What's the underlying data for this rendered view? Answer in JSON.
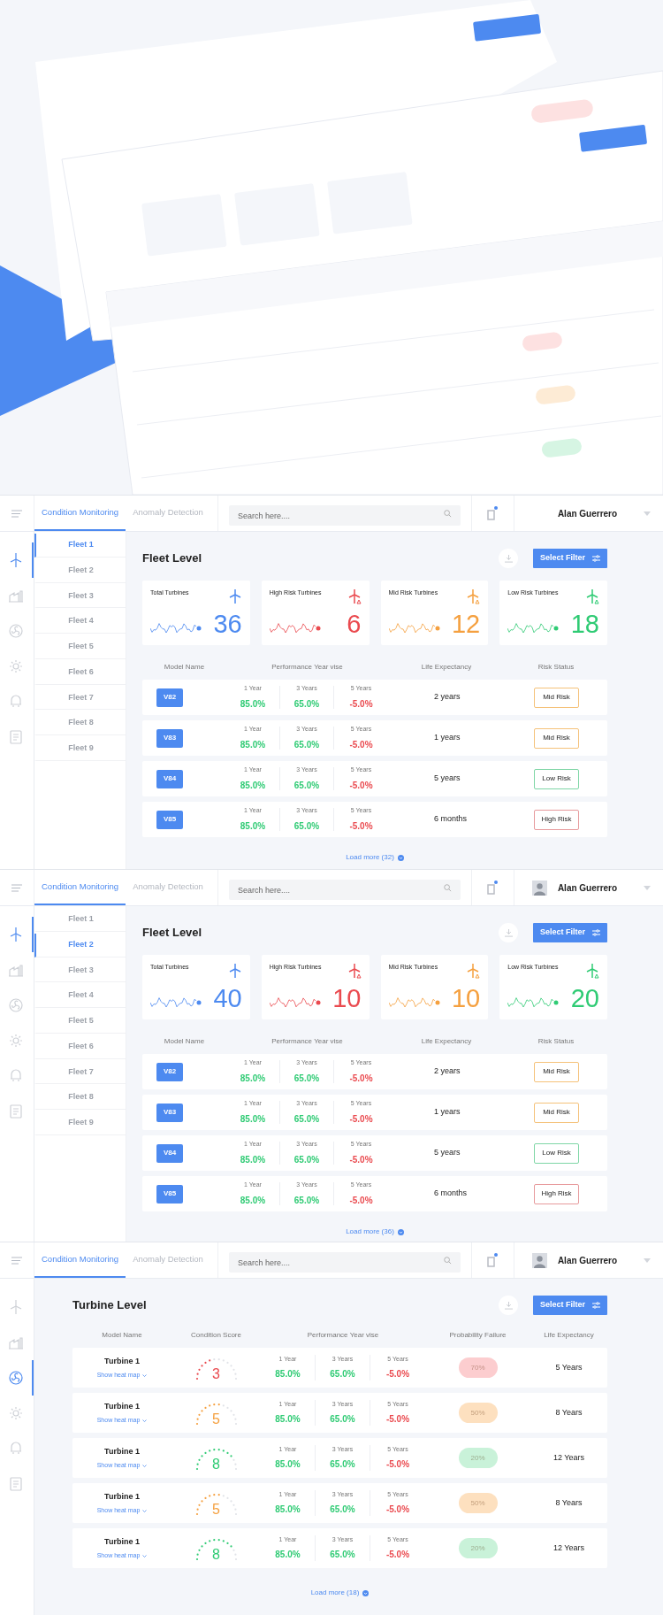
{
  "screens": [
    {
      "kind": "fleet",
      "header": {
        "tabs": [
          {
            "label": "Condition Monitoring",
            "selected": true
          },
          {
            "label": "Anomaly Detection",
            "selected": false
          }
        ],
        "search": {
          "placeholder": "Search here...."
        },
        "user": {
          "name": "Alan Guerrero",
          "avatar": false
        }
      },
      "rail": [
        {
          "selected": true
        },
        {
          "selected": false
        },
        {
          "selected": false
        },
        {
          "selected": false
        },
        {
          "selected": false
        },
        {
          "selected": false
        }
      ],
      "fleets": [
        {
          "label": "Fleet 1",
          "selected": true
        },
        {
          "label": "Fleet 2",
          "selected": false
        },
        {
          "label": "Fleet 3",
          "selected": false
        },
        {
          "label": "Fleet 4",
          "selected": false
        },
        {
          "label": "Fleet 5",
          "selected": false
        },
        {
          "label": "Fleet 6",
          "selected": false
        },
        {
          "label": "Fleet 7",
          "selected": false
        },
        {
          "label": "Fleet 8",
          "selected": false
        },
        {
          "label": "Fleet 9",
          "selected": false
        }
      ],
      "title": "Fleet Level",
      "filter_button": "Select Filter",
      "cards": [
        {
          "label": "Total Turbines",
          "value": "36",
          "color": "#4d8af0"
        },
        {
          "label": "High Risk Turbines",
          "value": "6",
          "color": "#ea4a4f"
        },
        {
          "label": "Mid Risk Turbines",
          "value": "12",
          "color": "#f5a03f"
        },
        {
          "label": "Low Risk Turbines",
          "value": "18",
          "color": "#2fcb74"
        }
      ],
      "columns": [
        "Model Name",
        "Performance Year vise",
        "Life Expectancy",
        "Risk Status"
      ],
      "rows": [
        {
          "model": "V82",
          "performance": [
            {
              "label": "1 Year",
              "value": "85.0%",
              "color": "#2fcb74"
            },
            {
              "label": "3 Years",
              "value": "65.0%",
              "color": "#2fcb74"
            },
            {
              "label": "5 Years",
              "value": "-5.0%",
              "color": "#ea4a4f"
            }
          ],
          "life": "2 years",
          "risk": {
            "label": "Mid Risk",
            "color": "#f5c27a"
          }
        },
        {
          "model": "V83",
          "performance": [
            {
              "label": "1 Year",
              "value": "85.0%",
              "color": "#2fcb74"
            },
            {
              "label": "3 Years",
              "value": "65.0%",
              "color": "#2fcb74"
            },
            {
              "label": "5 Years",
              "value": "-5.0%",
              "color": "#ea4a4f"
            }
          ],
          "life": "1 years",
          "risk": {
            "label": "Mid Risk",
            "color": "#f5c27a"
          }
        },
        {
          "model": "V84",
          "performance": [
            {
              "label": "1 Year",
              "value": "85.0%",
              "color": "#2fcb74"
            },
            {
              "label": "3 Years",
              "value": "65.0%",
              "color": "#2fcb74"
            },
            {
              "label": "5 Years",
              "value": "-5.0%",
              "color": "#ea4a4f"
            }
          ],
          "life": "5 years",
          "risk": {
            "label": "Low Risk",
            "color": "#7fd6a6"
          }
        },
        {
          "model": "V85",
          "performance": [
            {
              "label": "1 Year",
              "value": "85.0%",
              "color": "#2fcb74"
            },
            {
              "label": "3 Years",
              "value": "65.0%",
              "color": "#2fcb74"
            },
            {
              "label": "5 Years",
              "value": "-5.0%",
              "color": "#ea4a4f"
            }
          ],
          "life": "6 months",
          "risk": {
            "label": "High Risk",
            "color": "#e79a9c"
          }
        }
      ],
      "load_more": "Load more (32)"
    },
    {
      "kind": "fleet",
      "header": {
        "tabs": [
          {
            "label": "Condition Monitoring",
            "selected": true
          },
          {
            "label": "Anomaly Detection",
            "selected": false
          }
        ],
        "search": {
          "placeholder": "Search here...."
        },
        "user": {
          "name": "Alan Guerrero",
          "avatar": true
        }
      },
      "rail": [
        {
          "selected": true
        },
        {
          "selected": false
        },
        {
          "selected": false
        },
        {
          "selected": false
        },
        {
          "selected": false
        },
        {
          "selected": false
        }
      ],
      "fleets": [
        {
          "label": "Fleet 1",
          "selected": false
        },
        {
          "label": "Fleet 2",
          "selected": true
        },
        {
          "label": "Fleet 3",
          "selected": false
        },
        {
          "label": "Fleet 4",
          "selected": false
        },
        {
          "label": "Fleet 5",
          "selected": false
        },
        {
          "label": "Fleet 6",
          "selected": false
        },
        {
          "label": "Fleet 7",
          "selected": false
        },
        {
          "label": "Fleet 8",
          "selected": false
        },
        {
          "label": "Fleet 9",
          "selected": false
        }
      ],
      "title": "Fleet Level",
      "filter_button": "Select Filter",
      "cards": [
        {
          "label": "Total Turbines",
          "value": "40",
          "color": "#4d8af0"
        },
        {
          "label": "High Risk Turbines",
          "value": "10",
          "color": "#ea4a4f"
        },
        {
          "label": "Mid Risk Turbines",
          "value": "10",
          "color": "#f5a03f"
        },
        {
          "label": "Low Risk Turbines",
          "value": "20",
          "color": "#2fcb74"
        }
      ],
      "columns": [
        "Model Name",
        "Performance Year vise",
        "Life Expectancy",
        "Risk Status"
      ],
      "rows": [
        {
          "model": "V82",
          "performance": [
            {
              "label": "1 Year",
              "value": "85.0%",
              "color": "#2fcb74"
            },
            {
              "label": "3 Years",
              "value": "65.0%",
              "color": "#2fcb74"
            },
            {
              "label": "5 Years",
              "value": "-5.0%",
              "color": "#ea4a4f"
            }
          ],
          "life": "2 years",
          "risk": {
            "label": "Mid Risk",
            "color": "#f5c27a"
          }
        },
        {
          "model": "V83",
          "performance": [
            {
              "label": "1 Year",
              "value": "85.0%",
              "color": "#2fcb74"
            },
            {
              "label": "3 Years",
              "value": "65.0%",
              "color": "#2fcb74"
            },
            {
              "label": "5 Years",
              "value": "-5.0%",
              "color": "#ea4a4f"
            }
          ],
          "life": "1 years",
          "risk": {
            "label": "Mid Risk",
            "color": "#f5c27a"
          }
        },
        {
          "model": "V84",
          "performance": [
            {
              "label": "1 Year",
              "value": "85.0%",
              "color": "#2fcb74"
            },
            {
              "label": "3 Years",
              "value": "65.0%",
              "color": "#2fcb74"
            },
            {
              "label": "5 Years",
              "value": "-5.0%",
              "color": "#ea4a4f"
            }
          ],
          "life": "5 years",
          "risk": {
            "label": "Low Risk",
            "color": "#7fd6a6"
          }
        },
        {
          "model": "V85",
          "performance": [
            {
              "label": "1 Year",
              "value": "85.0%",
              "color": "#2fcb74"
            },
            {
              "label": "3 Years",
              "value": "65.0%",
              "color": "#2fcb74"
            },
            {
              "label": "5 Years",
              "value": "-5.0%",
              "color": "#ea4a4f"
            }
          ],
          "life": "6 months",
          "risk": {
            "label": "High Risk",
            "color": "#e79a9c"
          }
        }
      ],
      "load_more": "Load more (36)"
    },
    {
      "kind": "turbine",
      "header": {
        "tabs": [
          {
            "label": "Condition Monitoring",
            "selected": true
          },
          {
            "label": "Anomaly Detection",
            "selected": false
          }
        ],
        "search": {
          "placeholder": "Search here...."
        },
        "user": {
          "name": "Alan Guerrero",
          "avatar": true
        }
      },
      "rail": [
        {
          "selected": false
        },
        {
          "selected": false
        },
        {
          "selected": true
        },
        {
          "selected": false
        },
        {
          "selected": false
        },
        {
          "selected": false
        }
      ],
      "title": "Turbine Level",
      "filter_button": "Select Filter",
      "columns": [
        "Model Name",
        "Condition Score",
        "Performance Year vise",
        "Probability Failure",
        "Life Expectancy"
      ],
      "rows": [
        {
          "name": "Turbine 1",
          "link": "Show heat map",
          "score": {
            "value": "3",
            "level": 0.4,
            "color": "#ea4a4f"
          },
          "performance": [
            {
              "label": "1 Year",
              "value": "85.0%",
              "color": "#2fcb74"
            },
            {
              "label": "3 Years",
              "value": "65.0%",
              "color": "#2fcb74"
            },
            {
              "label": "5 Years",
              "value": "-5.0%",
              "color": "#ea4a4f"
            }
          ],
          "failure": {
            "label": "70%",
            "color": "#fccdcf"
          },
          "life": "5 Years"
        },
        {
          "name": "Turbine 1",
          "link": "Show heat map",
          "score": {
            "value": "5",
            "level": 0.55,
            "color": "#f5a03f"
          },
          "performance": [
            {
              "label": "1 Year",
              "value": "85.0%",
              "color": "#2fcb74"
            },
            {
              "label": "3 Years",
              "value": "65.0%",
              "color": "#2fcb74"
            },
            {
              "label": "5 Years",
              "value": "-5.0%",
              "color": "#ea4a4f"
            }
          ],
          "failure": {
            "label": "50%",
            "color": "#fde0bf"
          },
          "life": "8 Years"
        },
        {
          "name": "Turbine 1",
          "link": "Show heat map",
          "score": {
            "value": "8",
            "level": 0.8,
            "color": "#2fcb74"
          },
          "performance": [
            {
              "label": "1 Year",
              "value": "85.0%",
              "color": "#2fcb74"
            },
            {
              "label": "3 Years",
              "value": "65.0%",
              "color": "#2fcb74"
            },
            {
              "label": "5 Years",
              "value": "-5.0%",
              "color": "#ea4a4f"
            }
          ],
          "failure": {
            "label": "20%",
            "color": "#c9f2d9"
          },
          "life": "12 Years"
        },
        {
          "name": "Turbine 1",
          "link": "Show heat map",
          "score": {
            "value": "5",
            "level": 0.55,
            "color": "#f5a03f"
          },
          "performance": [
            {
              "label": "1 Year",
              "value": "85.0%",
              "color": "#2fcb74"
            },
            {
              "label": "3 Years",
              "value": "65.0%",
              "color": "#2fcb74"
            },
            {
              "label": "5 Years",
              "value": "-5.0%",
              "color": "#ea4a4f"
            }
          ],
          "failure": {
            "label": "50%",
            "color": "#fde0bf"
          },
          "life": "8 Years"
        },
        {
          "name": "Turbine 1",
          "link": "Show heat map",
          "score": {
            "value": "8",
            "level": 0.8,
            "color": "#2fcb74"
          },
          "performance": [
            {
              "label": "1 Year",
              "value": "85.0%",
              "color": "#2fcb74"
            },
            {
              "label": "3 Years",
              "value": "65.0%",
              "color": "#2fcb74"
            },
            {
              "label": "5 Years",
              "value": "-5.0%",
              "color": "#ea4a4f"
            }
          ],
          "failure": {
            "label": "20%",
            "color": "#c9f2d9"
          },
          "life": "12 Years"
        }
      ],
      "load_more": "Load more (18)"
    }
  ]
}
